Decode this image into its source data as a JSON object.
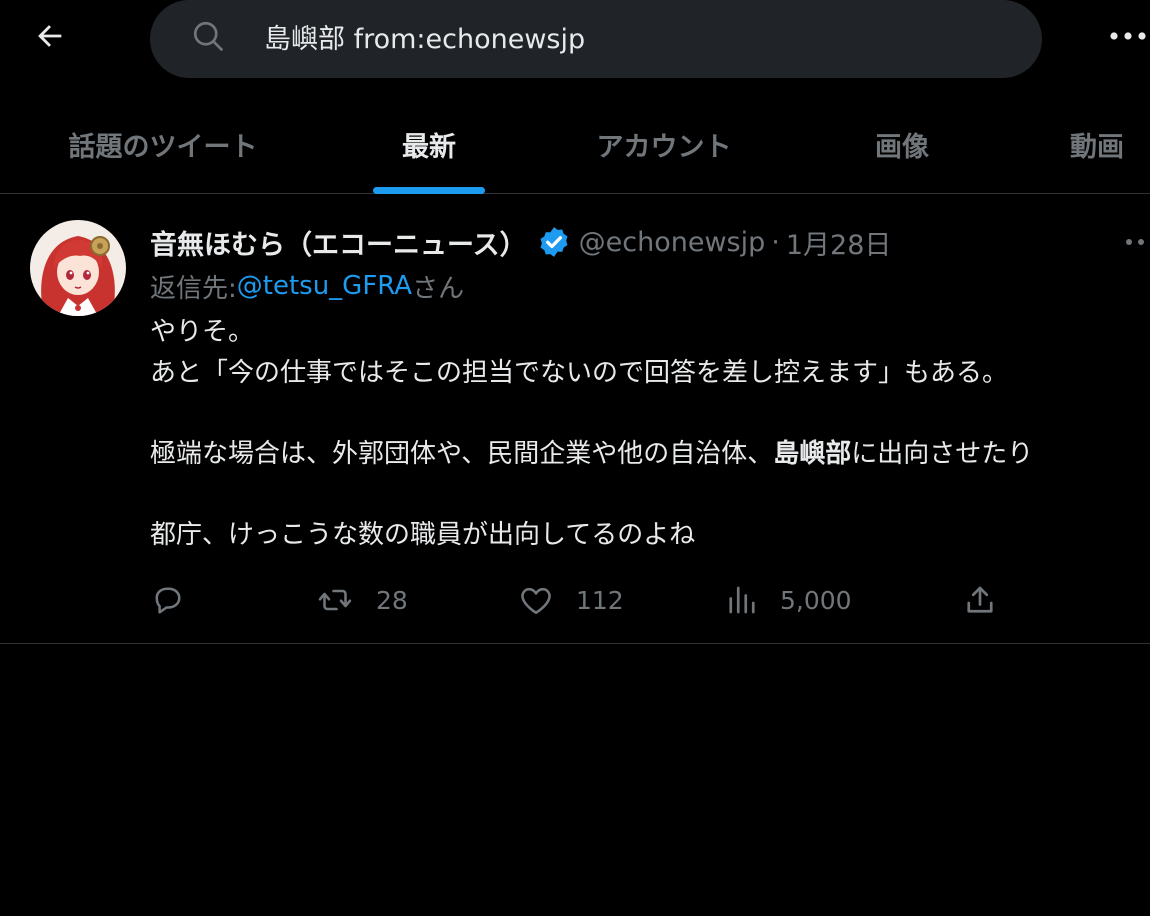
{
  "header": {
    "search_value": "島嶼部 from:echonewsjp"
  },
  "tabs": [
    {
      "label": "話題のツイート"
    },
    {
      "label": "最新"
    },
    {
      "label": "アカウント"
    },
    {
      "label": "画像"
    },
    {
      "label": "動画"
    }
  ],
  "active_tab": "最新",
  "tweet": {
    "display_name": "音無ほむら（エコーニュース）",
    "handle": "@echonewsjp",
    "separator": "·",
    "date": "1月28日",
    "reply_prefix": "返信先: ",
    "reply_to": "@tetsu_GFRA",
    "reply_suffix": "さん",
    "text": {
      "line1": "やりそ。",
      "line2": "あと「今の仕事ではそこの担当でないので回答を差し控えます」もある。",
      "line3_a": "極端な場合は、外郭団体や、民間企業や他の自治体、",
      "line3_hl": "島嶼部",
      "line3_b": "に出向させたり",
      "line4": "都庁、けっこうな数の職員が出向してるのよね"
    },
    "retweet_count": "28",
    "like_count": "112",
    "view_count": "5,000"
  },
  "colors": {
    "background": "#000000",
    "search_bg": "#202327",
    "accent": "#1d9bf0",
    "muted": "#71767b",
    "text": "#e7e9ea",
    "divider": "#2f3336"
  }
}
